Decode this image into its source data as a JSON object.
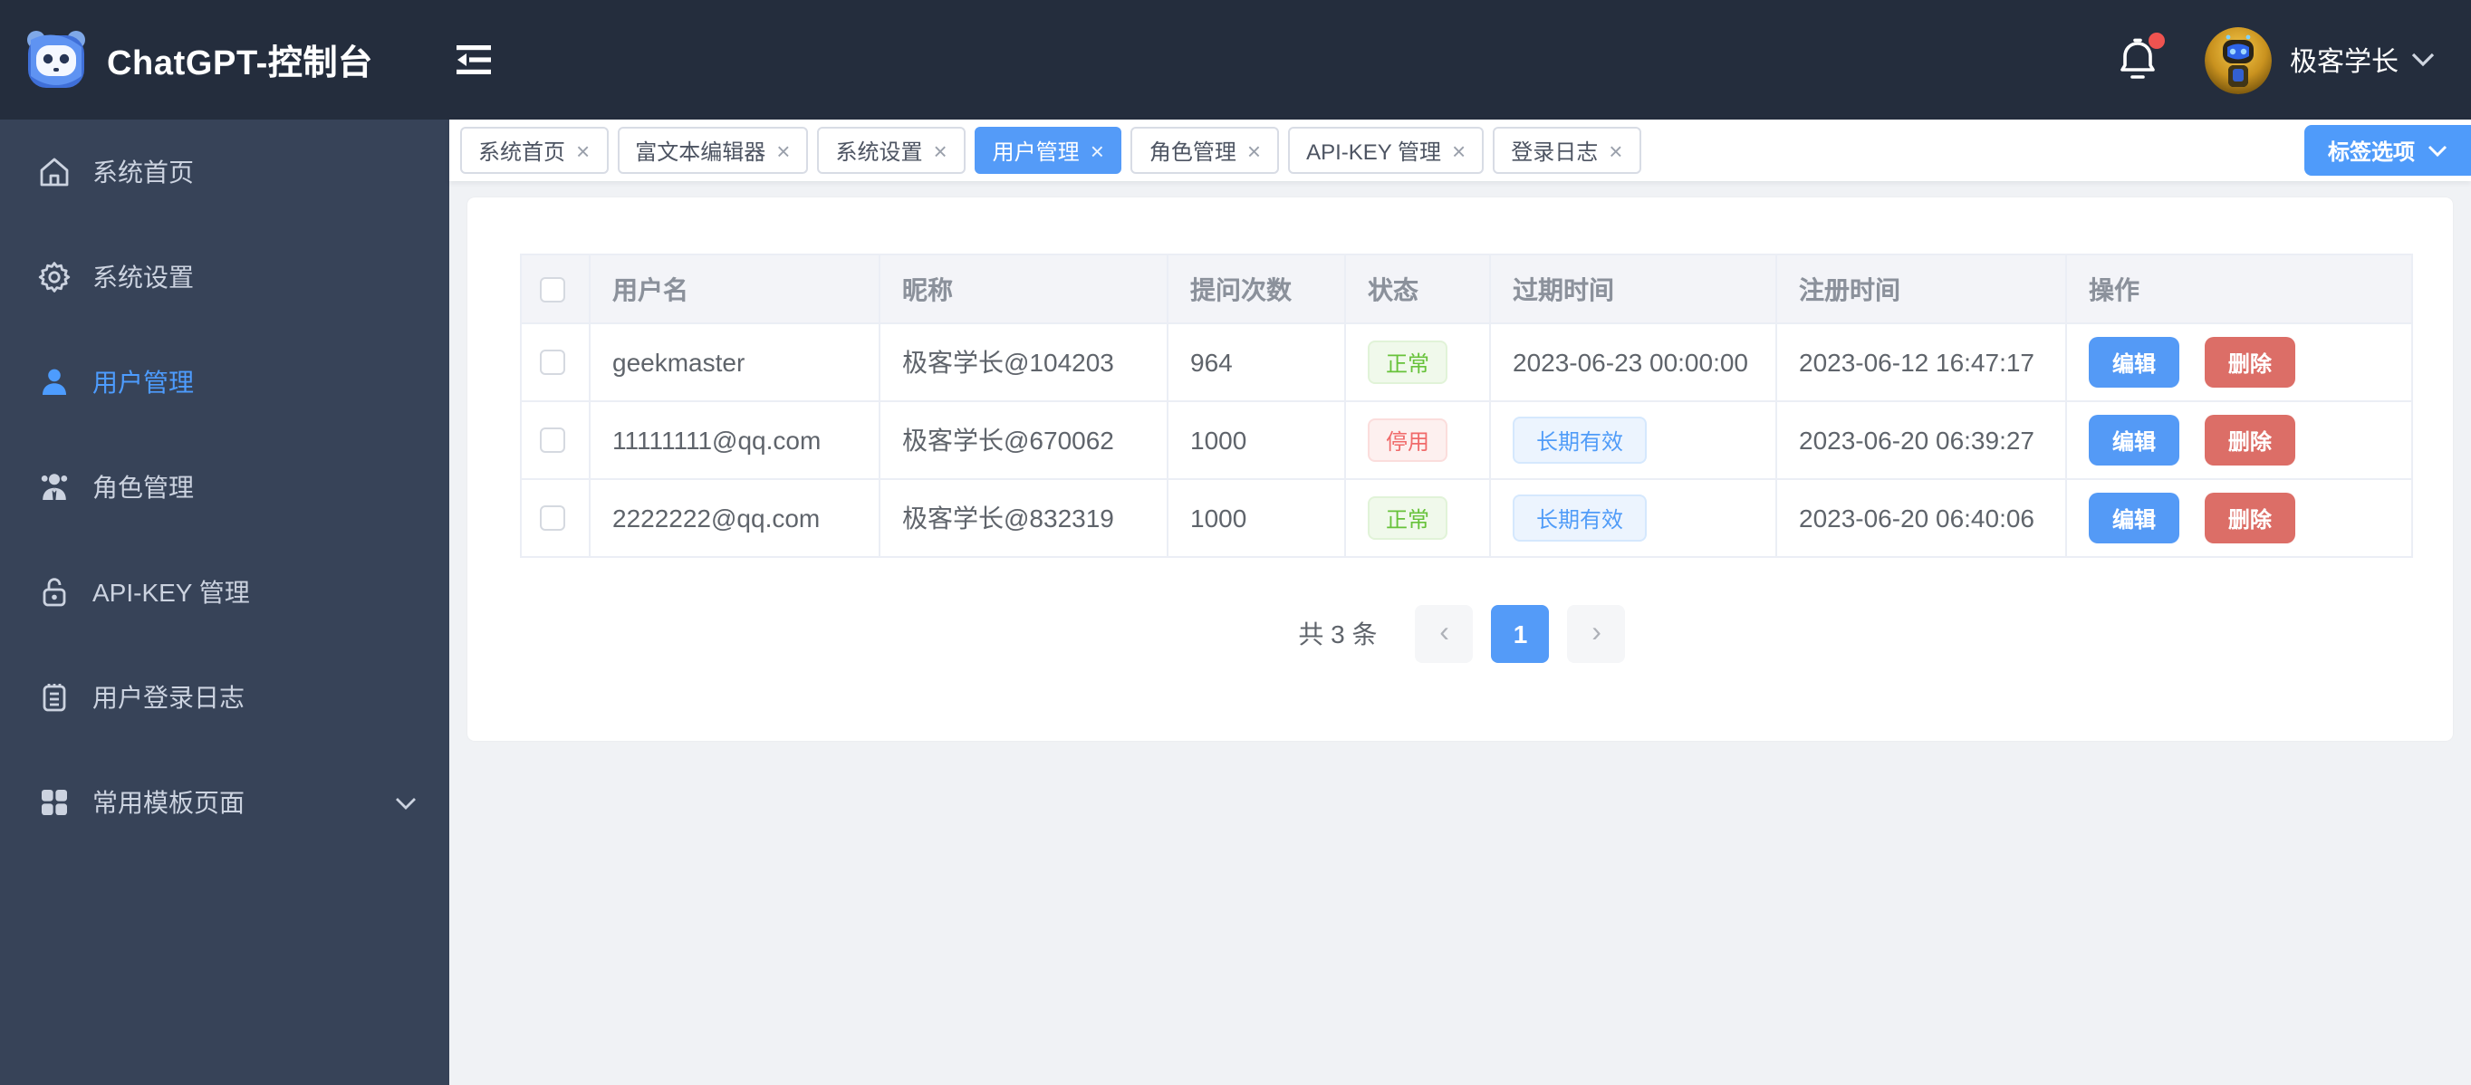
{
  "header": {
    "title": "ChatGPT-控制台",
    "username": "极客学长"
  },
  "sidebar": {
    "items": [
      {
        "label": "系统首页",
        "icon": "home-icon",
        "active": false
      },
      {
        "label": "系统设置",
        "icon": "gear-icon",
        "active": false
      },
      {
        "label": "用户管理",
        "icon": "user-icon",
        "active": true
      },
      {
        "label": "角色管理",
        "icon": "role-icon",
        "active": false
      },
      {
        "label": "API-KEY 管理",
        "icon": "lock-icon",
        "active": false
      },
      {
        "label": "用户登录日志",
        "icon": "log-icon",
        "active": false
      },
      {
        "label": "常用模板页面",
        "icon": "grid-icon",
        "active": false,
        "expandable": true
      }
    ]
  },
  "tabbar": {
    "close_glyph": "×",
    "tabs": [
      {
        "label": "系统首页",
        "active": false
      },
      {
        "label": "富文本编辑器",
        "active": false
      },
      {
        "label": "系统设置",
        "active": false
      },
      {
        "label": "用户管理",
        "active": true
      },
      {
        "label": "角色管理",
        "active": false
      },
      {
        "label": "API-KEY 管理",
        "active": false
      },
      {
        "label": "登录日志",
        "active": false
      }
    ],
    "options_button": {
      "label": "标签选项"
    }
  },
  "table": {
    "columns": [
      "用户名",
      "昵称",
      "提问次数",
      "状态",
      "过期时间",
      "注册时间",
      "操作"
    ],
    "rows": [
      {
        "username": "geekmaster",
        "nickname": "极客学长@104203",
        "questions": "964",
        "status": {
          "label": "正常",
          "type": "success"
        },
        "expire": {
          "label": "2023-06-23 00:00:00",
          "type": "text"
        },
        "registered": "2023-06-12 16:47:17",
        "actions": {
          "edit": "编辑",
          "delete": "删除"
        }
      },
      {
        "username": "11111111@qq.com",
        "nickname": "极客学长@670062",
        "questions": "1000",
        "status": {
          "label": "停用",
          "type": "danger"
        },
        "expire": {
          "label": "长期有效",
          "type": "tag"
        },
        "registered": "2023-06-20 06:39:27",
        "actions": {
          "edit": "编辑",
          "delete": "删除"
        }
      },
      {
        "username": "2222222@qq.com",
        "nickname": "极客学长@832319",
        "questions": "1000",
        "status": {
          "label": "正常",
          "type": "success"
        },
        "expire": {
          "label": "长期有效",
          "type": "tag"
        },
        "registered": "2023-06-20 06:40:06",
        "actions": {
          "edit": "编辑",
          "delete": "删除"
        }
      }
    ]
  },
  "pagination": {
    "total": "共 3 条",
    "page": "1",
    "prev_glyph": "‹",
    "next_glyph": "›"
  },
  "colors": {
    "topbar_bg": "#242d3d",
    "sidebar_bg": "#374358",
    "accent_blue": "#549bf8",
    "danger_red": "#dc6e67",
    "success_green": "#67c23a",
    "content_bg": "#f0f2f5"
  }
}
